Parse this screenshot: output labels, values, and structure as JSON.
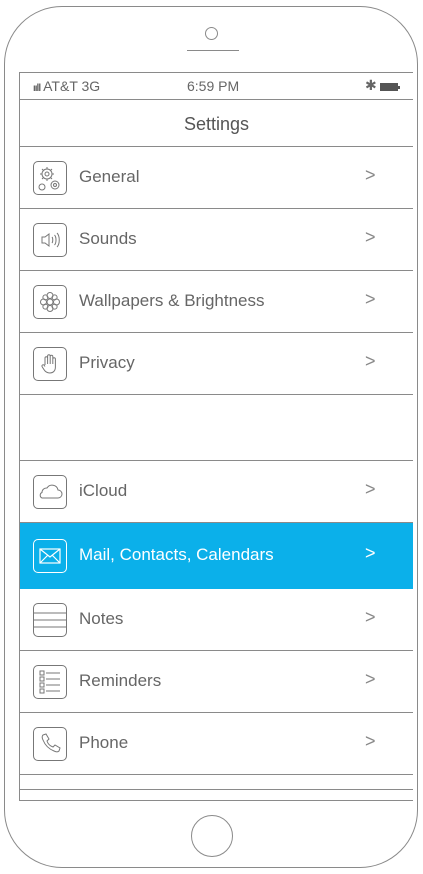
{
  "status_bar": {
    "signal": "ııll",
    "carrier": "AT&T 3G",
    "time": "6:59 PM",
    "bluetooth": "✱"
  },
  "nav": {
    "title": "Settings"
  },
  "settings": {
    "items": [
      {
        "label": "General",
        "icon": "gear-icon",
        "chevron": ">"
      },
      {
        "label": "Sounds",
        "icon": "speaker-icon",
        "chevron": ">"
      },
      {
        "label": "Wallpapers & Brightness",
        "icon": "flower-icon",
        "chevron": ">"
      },
      {
        "label": "Privacy",
        "icon": "hand-icon",
        "chevron": ">"
      },
      {
        "label": "iCloud",
        "icon": "cloud-icon",
        "chevron": ">"
      },
      {
        "label": "Mail, Contacts, Calendars",
        "icon": "envelope-icon",
        "chevron": ">",
        "selected": true
      },
      {
        "label": "Notes",
        "icon": "notes-icon",
        "chevron": ">"
      },
      {
        "label": "Reminders",
        "icon": "reminders-icon",
        "chevron": ">"
      },
      {
        "label": "Phone",
        "icon": "phone-icon",
        "chevron": ">"
      }
    ]
  },
  "colors": {
    "selected_row": "#0bb0ea",
    "frame": "#8a8a8a",
    "text": "#666666"
  }
}
